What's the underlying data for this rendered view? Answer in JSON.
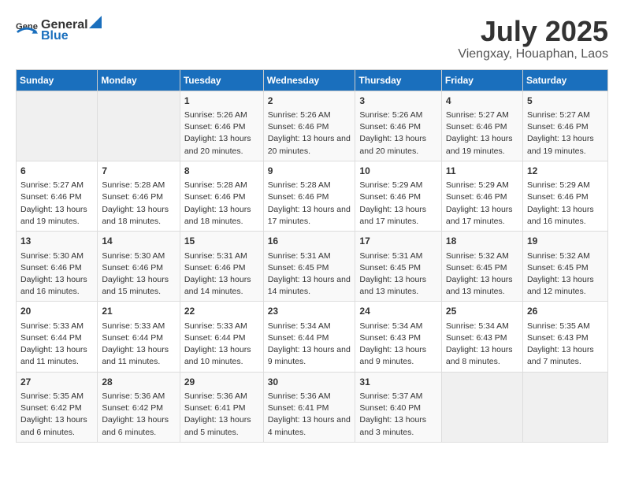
{
  "logo": {
    "general": "General",
    "blue": "Blue"
  },
  "header": {
    "month": "July 2025",
    "location": "Viengxay, Houaphan, Laos"
  },
  "weekdays": [
    "Sunday",
    "Monday",
    "Tuesday",
    "Wednesday",
    "Thursday",
    "Friday",
    "Saturday"
  ],
  "weeks": [
    [
      {
        "day": "",
        "sunrise": "",
        "sunset": "",
        "daylight": "",
        "empty": true
      },
      {
        "day": "",
        "sunrise": "",
        "sunset": "",
        "daylight": "",
        "empty": true
      },
      {
        "day": "1",
        "sunrise": "Sunrise: 5:26 AM",
        "sunset": "Sunset: 6:46 PM",
        "daylight": "Daylight: 13 hours and 20 minutes."
      },
      {
        "day": "2",
        "sunrise": "Sunrise: 5:26 AM",
        "sunset": "Sunset: 6:46 PM",
        "daylight": "Daylight: 13 hours and 20 minutes."
      },
      {
        "day": "3",
        "sunrise": "Sunrise: 5:26 AM",
        "sunset": "Sunset: 6:46 PM",
        "daylight": "Daylight: 13 hours and 20 minutes."
      },
      {
        "day": "4",
        "sunrise": "Sunrise: 5:27 AM",
        "sunset": "Sunset: 6:46 PM",
        "daylight": "Daylight: 13 hours and 19 minutes."
      },
      {
        "day": "5",
        "sunrise": "Sunrise: 5:27 AM",
        "sunset": "Sunset: 6:46 PM",
        "daylight": "Daylight: 13 hours and 19 minutes."
      }
    ],
    [
      {
        "day": "6",
        "sunrise": "Sunrise: 5:27 AM",
        "sunset": "Sunset: 6:46 PM",
        "daylight": "Daylight: 13 hours and 19 minutes."
      },
      {
        "day": "7",
        "sunrise": "Sunrise: 5:28 AM",
        "sunset": "Sunset: 6:46 PM",
        "daylight": "Daylight: 13 hours and 18 minutes."
      },
      {
        "day": "8",
        "sunrise": "Sunrise: 5:28 AM",
        "sunset": "Sunset: 6:46 PM",
        "daylight": "Daylight: 13 hours and 18 minutes."
      },
      {
        "day": "9",
        "sunrise": "Sunrise: 5:28 AM",
        "sunset": "Sunset: 6:46 PM",
        "daylight": "Daylight: 13 hours and 17 minutes."
      },
      {
        "day": "10",
        "sunrise": "Sunrise: 5:29 AM",
        "sunset": "Sunset: 6:46 PM",
        "daylight": "Daylight: 13 hours and 17 minutes."
      },
      {
        "day": "11",
        "sunrise": "Sunrise: 5:29 AM",
        "sunset": "Sunset: 6:46 PM",
        "daylight": "Daylight: 13 hours and 17 minutes."
      },
      {
        "day": "12",
        "sunrise": "Sunrise: 5:29 AM",
        "sunset": "Sunset: 6:46 PM",
        "daylight": "Daylight: 13 hours and 16 minutes."
      }
    ],
    [
      {
        "day": "13",
        "sunrise": "Sunrise: 5:30 AM",
        "sunset": "Sunset: 6:46 PM",
        "daylight": "Daylight: 13 hours and 16 minutes."
      },
      {
        "day": "14",
        "sunrise": "Sunrise: 5:30 AM",
        "sunset": "Sunset: 6:46 PM",
        "daylight": "Daylight: 13 hours and 15 minutes."
      },
      {
        "day": "15",
        "sunrise": "Sunrise: 5:31 AM",
        "sunset": "Sunset: 6:46 PM",
        "daylight": "Daylight: 13 hours and 14 minutes."
      },
      {
        "day": "16",
        "sunrise": "Sunrise: 5:31 AM",
        "sunset": "Sunset: 6:45 PM",
        "daylight": "Daylight: 13 hours and 14 minutes."
      },
      {
        "day": "17",
        "sunrise": "Sunrise: 5:31 AM",
        "sunset": "Sunset: 6:45 PM",
        "daylight": "Daylight: 13 hours and 13 minutes."
      },
      {
        "day": "18",
        "sunrise": "Sunrise: 5:32 AM",
        "sunset": "Sunset: 6:45 PM",
        "daylight": "Daylight: 13 hours and 13 minutes."
      },
      {
        "day": "19",
        "sunrise": "Sunrise: 5:32 AM",
        "sunset": "Sunset: 6:45 PM",
        "daylight": "Daylight: 13 hours and 12 minutes."
      }
    ],
    [
      {
        "day": "20",
        "sunrise": "Sunrise: 5:33 AM",
        "sunset": "Sunset: 6:44 PM",
        "daylight": "Daylight: 13 hours and 11 minutes."
      },
      {
        "day": "21",
        "sunrise": "Sunrise: 5:33 AM",
        "sunset": "Sunset: 6:44 PM",
        "daylight": "Daylight: 13 hours and 11 minutes."
      },
      {
        "day": "22",
        "sunrise": "Sunrise: 5:33 AM",
        "sunset": "Sunset: 6:44 PM",
        "daylight": "Daylight: 13 hours and 10 minutes."
      },
      {
        "day": "23",
        "sunrise": "Sunrise: 5:34 AM",
        "sunset": "Sunset: 6:44 PM",
        "daylight": "Daylight: 13 hours and 9 minutes."
      },
      {
        "day": "24",
        "sunrise": "Sunrise: 5:34 AM",
        "sunset": "Sunset: 6:43 PM",
        "daylight": "Daylight: 13 hours and 9 minutes."
      },
      {
        "day": "25",
        "sunrise": "Sunrise: 5:34 AM",
        "sunset": "Sunset: 6:43 PM",
        "daylight": "Daylight: 13 hours and 8 minutes."
      },
      {
        "day": "26",
        "sunrise": "Sunrise: 5:35 AM",
        "sunset": "Sunset: 6:43 PM",
        "daylight": "Daylight: 13 hours and 7 minutes."
      }
    ],
    [
      {
        "day": "27",
        "sunrise": "Sunrise: 5:35 AM",
        "sunset": "Sunset: 6:42 PM",
        "daylight": "Daylight: 13 hours and 6 minutes."
      },
      {
        "day": "28",
        "sunrise": "Sunrise: 5:36 AM",
        "sunset": "Sunset: 6:42 PM",
        "daylight": "Daylight: 13 hours and 6 minutes."
      },
      {
        "day": "29",
        "sunrise": "Sunrise: 5:36 AM",
        "sunset": "Sunset: 6:41 PM",
        "daylight": "Daylight: 13 hours and 5 minutes."
      },
      {
        "day": "30",
        "sunrise": "Sunrise: 5:36 AM",
        "sunset": "Sunset: 6:41 PM",
        "daylight": "Daylight: 13 hours and 4 minutes."
      },
      {
        "day": "31",
        "sunrise": "Sunrise: 5:37 AM",
        "sunset": "Sunset: 6:40 PM",
        "daylight": "Daylight: 13 hours and 3 minutes."
      },
      {
        "day": "",
        "sunrise": "",
        "sunset": "",
        "daylight": "",
        "empty": true
      },
      {
        "day": "",
        "sunrise": "",
        "sunset": "",
        "daylight": "",
        "empty": true
      }
    ]
  ]
}
